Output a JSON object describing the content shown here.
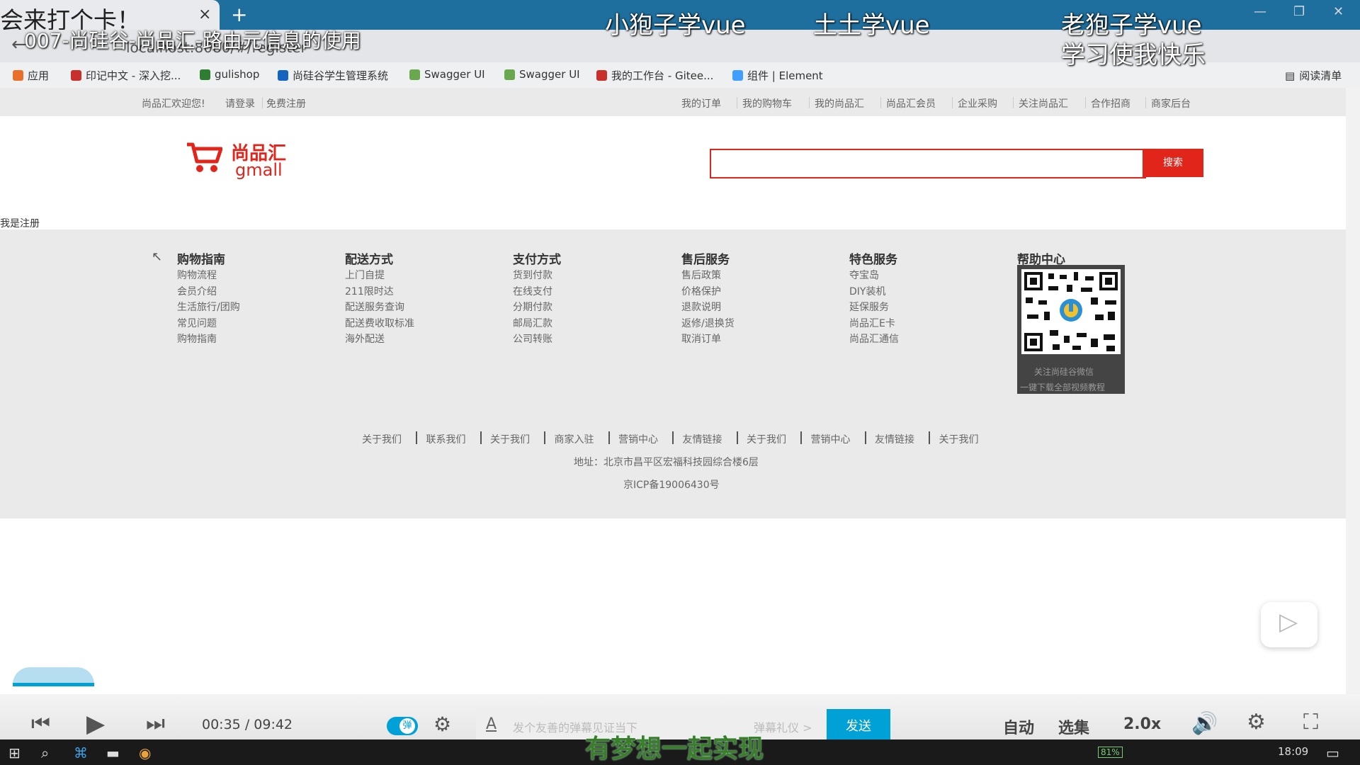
{
  "browser": {
    "tab_title": "会来打个卡！",
    "tab_close": "×",
    "new_tab": "+",
    "address": "localhost:8080/#/register",
    "bookmarks": [
      {
        "label": "应用",
        "color": "#e8702a"
      },
      {
        "label": "印记中文 - 深入挖...",
        "color": "#c9302c"
      },
      {
        "label": "gulishop",
        "color": "#2e7d32"
      },
      {
        "label": "尚硅谷学生管理系统",
        "color": "#1565c0"
      },
      {
        "label": "Swagger UI",
        "color": "#6aa84f"
      },
      {
        "label": "Swagger UI",
        "color": "#6aa84f"
      },
      {
        "label": "我的工作台 - Gitee...",
        "color": "#c9302c"
      },
      {
        "label": "组件 | Element",
        "color": "#409eff"
      }
    ],
    "reading_list": "阅读清单"
  },
  "video": {
    "title": "007-尚硅谷-尚品汇-路由元信息的使用",
    "danmu": [
      "小狍子学vue",
      "土土学vue",
      "老狍子学vue",
      "学习使我快乐"
    ],
    "motto": "有梦想一起实现"
  },
  "site": {
    "welcome": "尚品汇欢迎您!",
    "login": "请登录",
    "register": "免费注册",
    "top_links": [
      "我的订单",
      "我的购物车",
      "我的尚品汇",
      "尚品汇会员",
      "企业采购",
      "关注尚品汇",
      "合作招商",
      "商家后台"
    ],
    "logo_cn": "尚品汇",
    "logo_en": "gmall",
    "search_button": "搜索",
    "register_text": "我是注册",
    "footer_columns": [
      {
        "title": "购物指南",
        "items": [
          "购物流程",
          "会员介绍",
          "生活旅行/团购",
          "常见问题",
          "购物指南"
        ]
      },
      {
        "title": "配送方式",
        "items": [
          "上门自提",
          "211限时达",
          "配送服务查询",
          "配送费收取标准",
          "海外配送"
        ]
      },
      {
        "title": "支付方式",
        "items": [
          "货到付款",
          "在线支付",
          "分期付款",
          "邮局汇款",
          "公司转账"
        ]
      },
      {
        "title": "售后服务",
        "items": [
          "售后政策",
          "价格保护",
          "退款说明",
          "返修/退换货",
          "取消订单"
        ]
      },
      {
        "title": "特色服务",
        "items": [
          "夺宝岛",
          "DIY装机",
          "延保服务",
          "尚品汇E卡",
          "尚品汇通信"
        ]
      }
    ],
    "help_center": "帮助中心",
    "qr_caption_1": "关注尚硅谷微信",
    "qr_caption_2": "一键下载全部视频教程",
    "footer_links": [
      "关于我们",
      "联系我们",
      "关于我们",
      "商家入驻",
      "营销中心",
      "友情链接",
      "关于我们",
      "营销中心",
      "友情链接",
      "关于我们"
    ],
    "address_line": "地址：北京市昌平区宏福科技园综合楼6层",
    "icp": "京ICP备19006430号"
  },
  "player": {
    "current_time": "00:35",
    "separator": "/",
    "duration": "09:42",
    "danmu_toggle": "弹",
    "danmu_placeholder": "发个友善的弹幕见证当下",
    "danmu_gift": "弹幕礼仪 >",
    "send": "发送",
    "quality": "自动",
    "episodes": "选集",
    "speed": "2.0x",
    "progress_fraction": 0.06
  },
  "taskbar": {
    "time": "18:09",
    "battery": "81%"
  }
}
